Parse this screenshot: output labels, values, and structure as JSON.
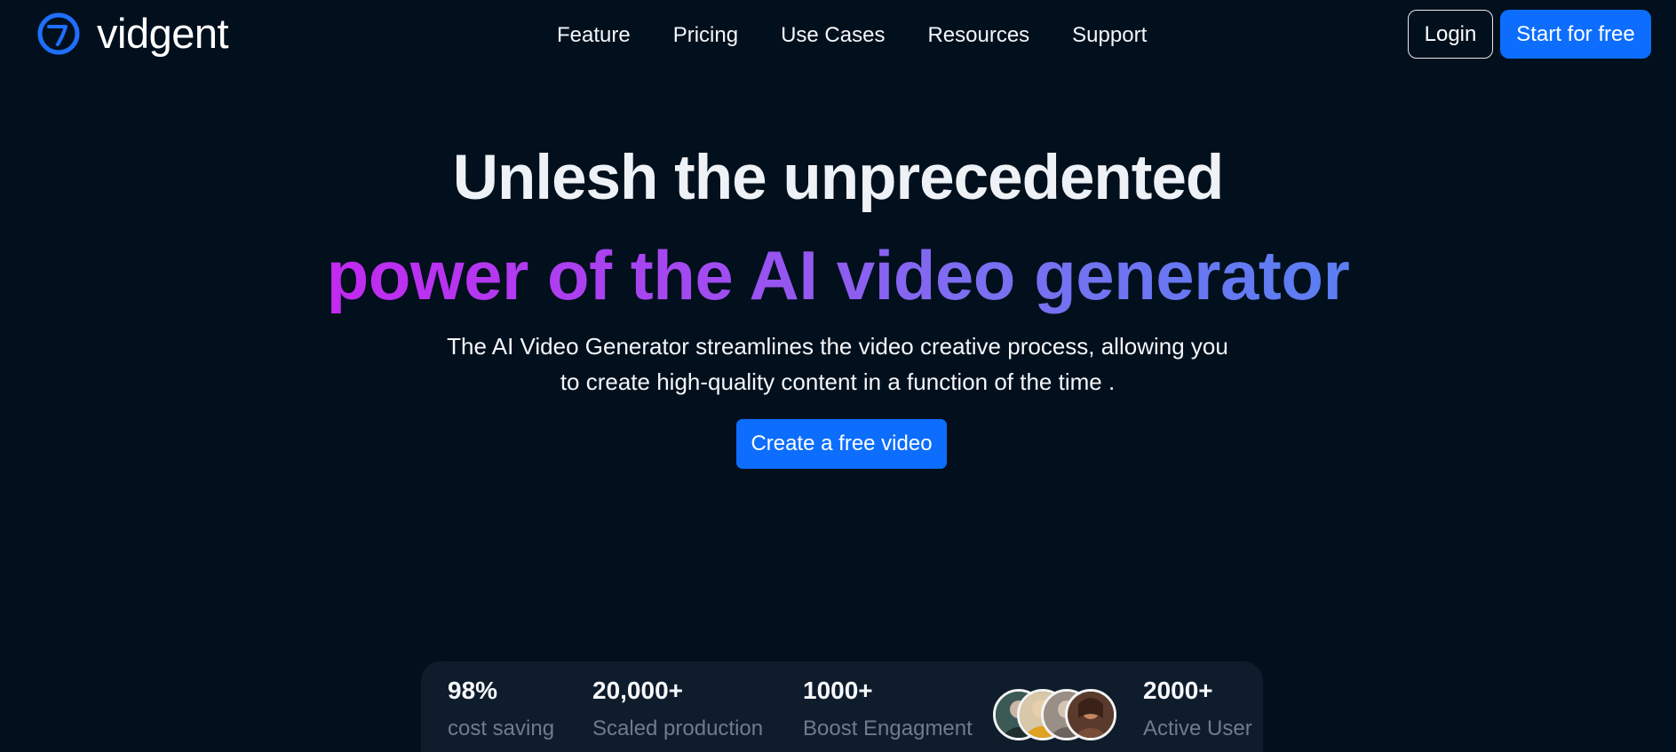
{
  "brand": {
    "name": "vidgent",
    "logo_icon": "circle-seven-logo-icon",
    "accent": "#1f6fff"
  },
  "nav": {
    "links": [
      "Feature",
      "Pricing",
      "Use Cases",
      "Resources",
      "Support"
    ],
    "login": "Login",
    "start": "Start for free"
  },
  "hero": {
    "title_line1": "Unlesh the unprecedented",
    "title_line2": "power of the AI video generator",
    "subtitle_line1": "The AI Video Generator streamlines the video creative process, allowing you",
    "subtitle_line2": "to create high-quality content in a function of the time .",
    "cta": "Create a free video"
  },
  "stats": [
    {
      "value": "98%",
      "label": "cost saving"
    },
    {
      "value": "20,000+",
      "label": "Scaled production"
    },
    {
      "value": "1000+",
      "label": "Boost Engagment"
    },
    {
      "value": "2000+",
      "label": "Active User"
    }
  ],
  "colors": {
    "background": "#02101d",
    "primary_button": "#0d6efd",
    "gradient_start": "#c229ef",
    "gradient_end": "#5a7ff2",
    "stats_panel": "#0e1c2b",
    "muted_text": "#6e7c8c"
  }
}
